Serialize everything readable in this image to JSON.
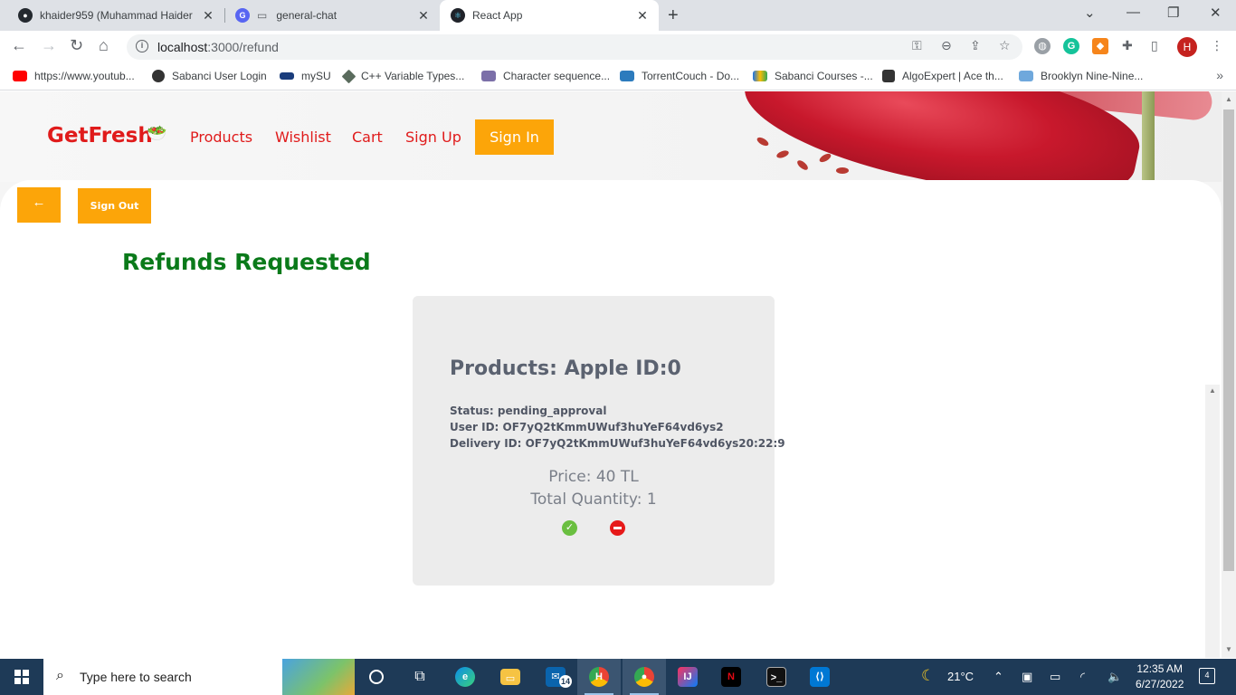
{
  "browser": {
    "tabs": [
      {
        "title": "khaider959 (Muhammad Haider",
        "close": "✕",
        "favicon_color": "#24292f",
        "active": false
      },
      {
        "title": "general-chat",
        "close": "✕",
        "favicon_color": "#5865f2",
        "active": false
      },
      {
        "title": "React App",
        "close": "✕",
        "favicon_color": "#20232a",
        "active": true
      }
    ],
    "new_tab": "+",
    "url_host": "localhost",
    "url_path": ":3000/refund",
    "profile_initial": "H",
    "bookmarks": [
      "https://www.youtub...",
      "Sabanci User Login",
      "mySU",
      "C++ Variable Types...",
      "Character sequence...",
      "TorrentCouch - Do...",
      "Sabanci Courses -...",
      "AlgoExpert | Ace th...",
      "Brooklyn Nine-Nine..."
    ],
    "bookmarks_more": "»"
  },
  "site": {
    "brand": "GetFresh",
    "nav": {
      "products": "Products",
      "wishlist": "Wishlist",
      "cart": "Cart",
      "signup": "Sign Up",
      "signin": "Sign In"
    },
    "back_label": "←",
    "signout_label": "Sign Out",
    "title": "Refunds Requested",
    "refunds": [
      {
        "product": "Products: Apple ID:0",
        "status": "Status: pending_approval",
        "user_id": "User ID: OF7yQ2tKmmUWuf3huYeF64vd6ys2",
        "delivery_id": "Delivery ID: OF7yQ2tKmmUWuf3huYeF64vd6ys20:22:9",
        "price": "Price: 40 TL",
        "quantity": "Total Quantity: 1"
      }
    ],
    "colors": {
      "brand_red": "#e01b1b",
      "button_orange": "#fca509",
      "title_green": "#0a7a1a",
      "approve_green": "#6abf40",
      "reject_red": "#e61919"
    }
  },
  "taskbar": {
    "search_placeholder": "Type here to search",
    "mail_badge": "14",
    "weather": "21°C",
    "time": "12:35 AM",
    "date": "6/27/2022",
    "notifications": "4"
  }
}
